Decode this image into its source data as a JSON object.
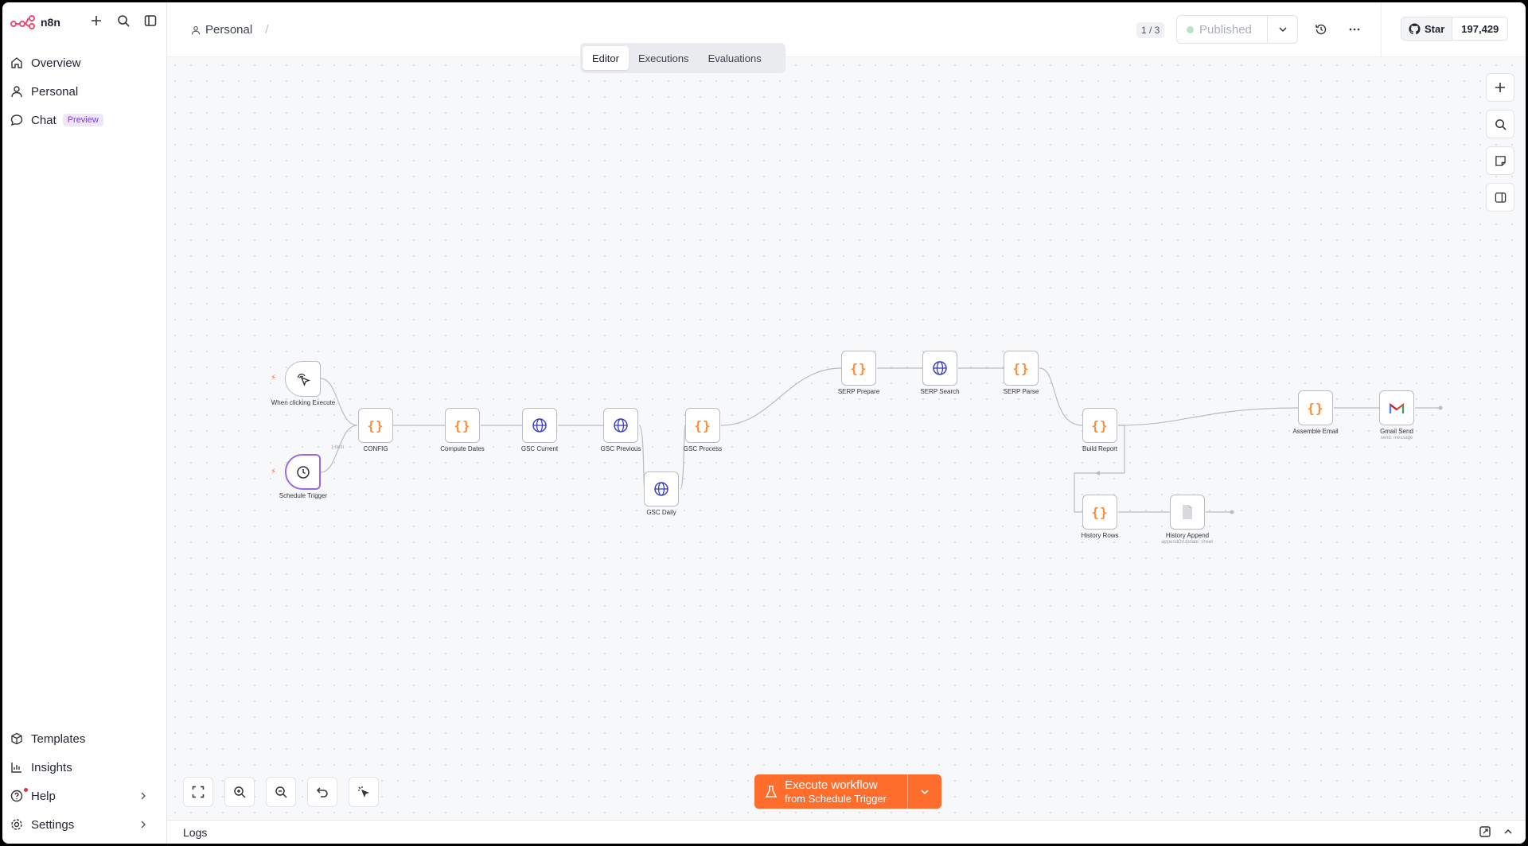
{
  "app": {
    "name": "n8n"
  },
  "sidebar": {
    "items": [
      {
        "label": "Overview"
      },
      {
        "label": "Personal"
      },
      {
        "label": "Chat",
        "badge": "Preview"
      }
    ],
    "bottom": [
      {
        "label": "Templates"
      },
      {
        "label": "Insights"
      },
      {
        "label": "Help"
      },
      {
        "label": "Settings"
      }
    ]
  },
  "header": {
    "breadcrumb": "Personal",
    "tabs": [
      "Editor",
      "Executions",
      "Evaluations"
    ],
    "active_tab": "Editor",
    "counter": "1 / 3",
    "publish_label": "Published",
    "github": {
      "star_label": "Star",
      "count": "197,429"
    }
  },
  "workflow": {
    "nodes": {
      "manual_trigger": "When clicking Execute",
      "schedule_trigger": "Schedule Trigger",
      "config": "CONFIG",
      "compute_dates": "Compute Dates",
      "gsc_current": "GSC Current",
      "gsc_previous": "GSC Previous",
      "gsc_daily": "GSC Daily",
      "gsc_process": "GSC Process",
      "serp_prepare": "SERP Prepare",
      "serp_search": "SERP Search",
      "serp_parse": "SERP Parse",
      "build_report": "Build Report",
      "assemble_email": "Assemble Email",
      "gmail_send": "Gmail Send",
      "gmail_send_sub": "send: message",
      "history_rows": "History Rows",
      "history_append": "History Append",
      "history_append_sub": "appendOrUpdate: sheet"
    },
    "connection_label": "1 item"
  },
  "execute": {
    "title": "Execute workflow",
    "subtitle": "from Schedule Trigger"
  },
  "logs": {
    "title": "Logs"
  },
  "colors": {
    "accent": "#ff6d2c",
    "trigger_selected": "#9b6ae0",
    "code_icon": "#ff8a33",
    "http_icon": "#3a3fbf"
  }
}
